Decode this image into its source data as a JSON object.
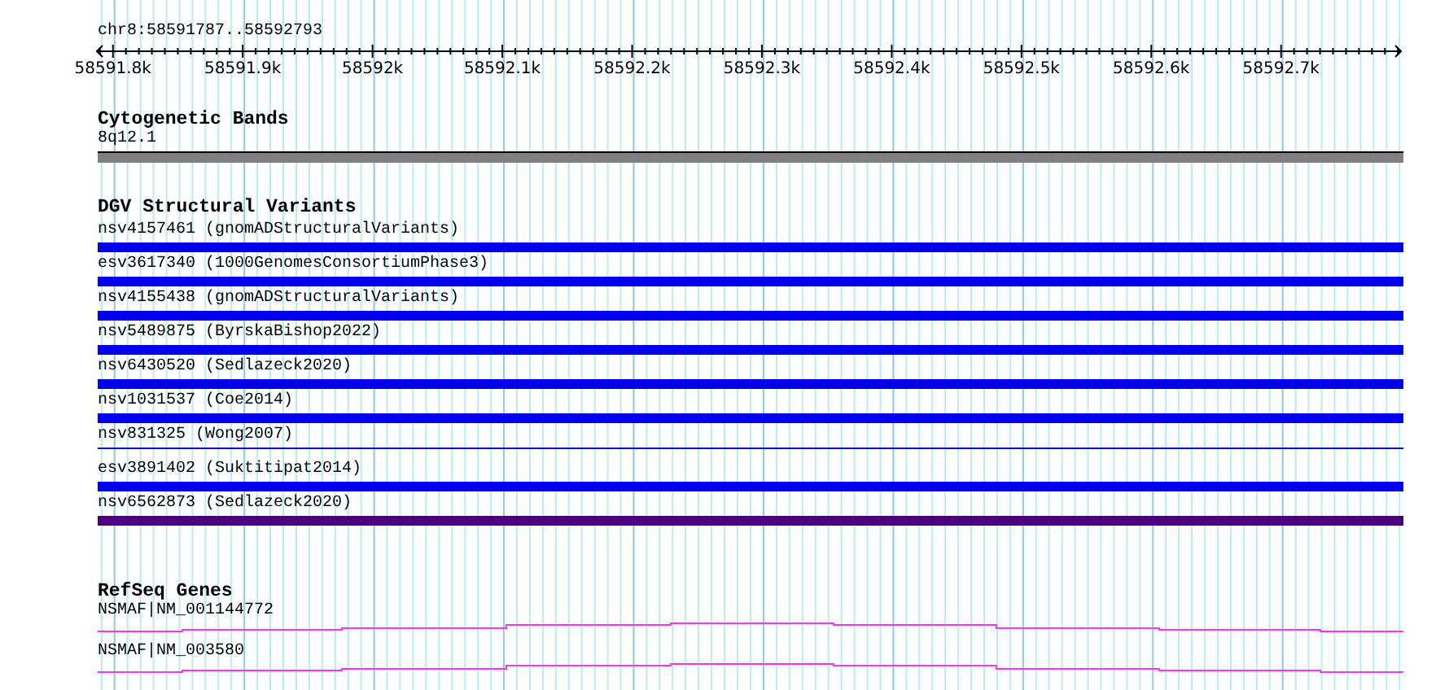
{
  "location": "chr8:58591787..58592793",
  "axis": {
    "labels": [
      "58591.8k",
      "58591.9k",
      "58592k",
      "58592.1k",
      "58592.2k",
      "58592.3k",
      "58592.4k",
      "58592.5k",
      "58592.6k",
      "58592.7k"
    ]
  },
  "cytogenetic_bands": {
    "title": "Cytogenetic Bands",
    "features": [
      {
        "label": "8q12.1",
        "color": "#808080"
      }
    ]
  },
  "dgv_structural_variants": {
    "title": "DGV Structural Variants",
    "features": [
      {
        "label": "nsv4157461 (gnomADStructuralVariants)",
        "kind": "bar",
        "color": "#0000ee"
      },
      {
        "label": "esv3617340 (1000GenomesConsortiumPhase3)",
        "kind": "bar",
        "color": "#0000ee"
      },
      {
        "label": "nsv4155438 (gnomADStructuralVariants)",
        "kind": "bar",
        "color": "#0000ee"
      },
      {
        "label": "nsv5489875 (ByrskaBishop2022)",
        "kind": "bar",
        "color": "#0000ee"
      },
      {
        "label": "nsv6430520 (Sedlazeck2020)",
        "kind": "bar",
        "color": "#0000ee"
      },
      {
        "label": "nsv1031537 (Coe2014)",
        "kind": "bar",
        "color": "#0000ee"
      },
      {
        "label": "nsv831325 (Wong2007)",
        "kind": "line",
        "color": "#0000ee"
      },
      {
        "label": "esv3891402 (Suktitipat2014)",
        "kind": "bar",
        "color": "#0000ee"
      },
      {
        "label": "nsv6562873 (Sedlazeck2020)",
        "kind": "bar",
        "color": "#4b0082"
      }
    ]
  },
  "refseq_genes": {
    "title": "RefSeq Genes",
    "features": [
      {
        "label": "NSMAF|NM_001144772"
      },
      {
        "label": "NSMAF|NM_003580"
      }
    ]
  }
}
